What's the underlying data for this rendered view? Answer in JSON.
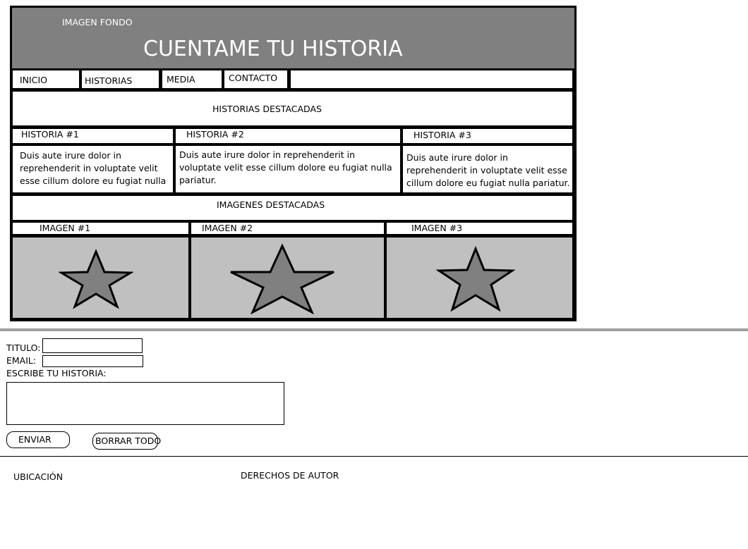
{
  "header": {
    "background_label": "IMAGEN FONDO",
    "title": "CUENTAME TU HISTORIA"
  },
  "nav": {
    "items": [
      "INICIO",
      "HISTORIAS",
      "MEDIA",
      "CONTACTO"
    ]
  },
  "featured_stories": {
    "heading": "HISTORIAS DESTACADAS",
    "stories": [
      {
        "title": "HISTORIA #1",
        "text": "Duis aute irure dolor in reprehenderit in voluptate velit esse cillum dolore eu fugiat nulla"
      },
      {
        "title": "HISTORIA #2",
        "text": "Duis aute irure dolor in reprehenderit in voluptate velit esse cillum dolore eu fugiat nulla pariatur."
      },
      {
        "title": "HISTORIA #3",
        "text": "Duis aute irure dolor in reprehenderit in voluptate velit esse cillum dolore eu fugiat nulla pariatur."
      }
    ]
  },
  "featured_images": {
    "heading": "IMAGENES DESTACADAS",
    "images": [
      {
        "title": "IMAGEN #1",
        "icon": "star-icon"
      },
      {
        "title": "IMAGEN #2",
        "icon": "star-icon"
      },
      {
        "title": "IMAGEN #3",
        "icon": "star-icon"
      }
    ]
  },
  "form": {
    "title_label": "TITULO:",
    "email_label": "EMAIL:",
    "story_label": "ESCRIBE TU HISTORIA:",
    "title_value": "",
    "email_value": "",
    "story_value": "",
    "submit_label": "ENVIAR",
    "clear_label": "BORRAR TODO"
  },
  "footer": {
    "location": "UBICACIÓN",
    "copyright": "DERECHOS DE AUTOR"
  },
  "colors": {
    "header_bg": "#808080",
    "image_bg": "#c0c0c0",
    "star_fill": "#808080"
  }
}
